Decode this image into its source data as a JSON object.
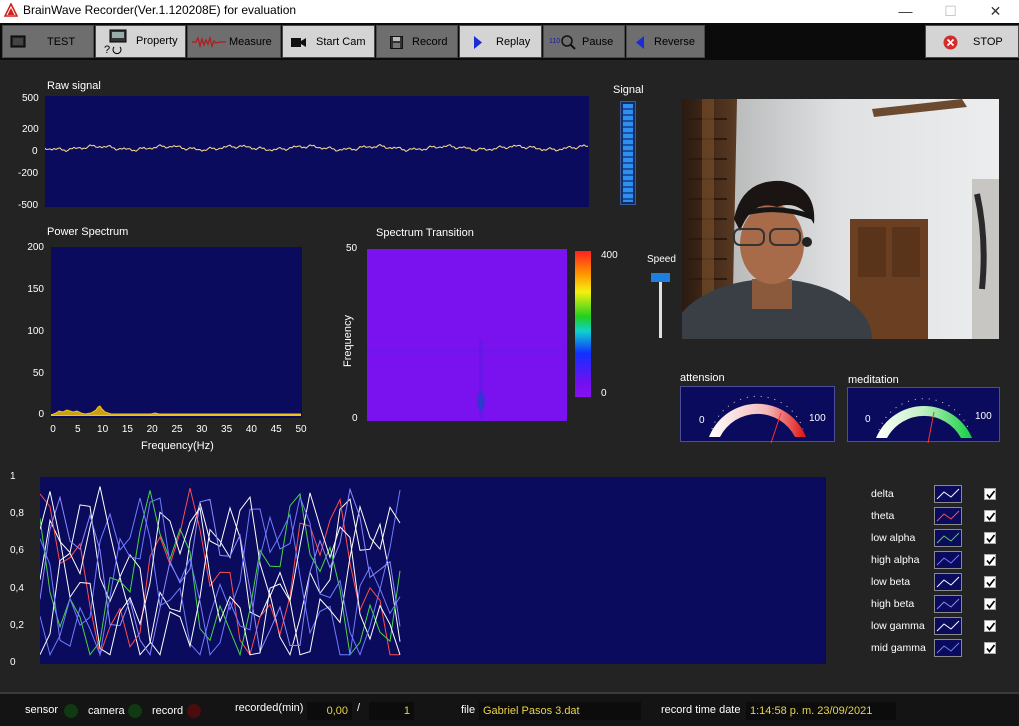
{
  "window": {
    "title": "BrainWave Recorder(Ver.1.120208E) for evaluation",
    "minimize": "—",
    "maximize": "☐",
    "close": "✕"
  },
  "toolbar": {
    "test": "TEST",
    "property": "Property",
    "measure": "Measure",
    "start_cam": "Start Cam",
    "record": "Record",
    "replay": "Replay",
    "pause": "Pause",
    "reverse": "Reverse",
    "stop": "STOP"
  },
  "raw_signal": {
    "title": "Raw signal",
    "yticks": [
      "500",
      "200",
      "0",
      "-200",
      "-500"
    ]
  },
  "signal_meter": {
    "title": "Signal",
    "level": 1.0
  },
  "power_spectrum": {
    "title": "Power Spectrum",
    "yticks": [
      "200",
      "150",
      "100",
      "50",
      "0"
    ],
    "xticks": [
      "0",
      "5",
      "10",
      "15",
      "20",
      "25",
      "30",
      "35",
      "40",
      "45",
      "50"
    ],
    "xlabel": "Frequency(Hz)"
  },
  "spectrum_transition": {
    "title": "Spectrum Transition",
    "ylabel": "Frequency",
    "ytick_top": "50",
    "ytick_bottom": "0",
    "scale_max": "400",
    "scale_min": "0"
  },
  "speed": {
    "title": "Speed"
  },
  "attension": {
    "title": "attension",
    "min": "0",
    "max": "100",
    "value": 72
  },
  "meditation": {
    "title": "meditation",
    "min": "0",
    "max": "100",
    "value": 55
  },
  "bands_chart": {
    "yticks": [
      "1",
      "0,8",
      "0,6",
      "0,4",
      "0,2",
      "0"
    ],
    "legend": [
      {
        "name": "delta",
        "color": "#ffffff"
      },
      {
        "name": "theta",
        "color": "#ff4c4c"
      },
      {
        "name": "low alpha",
        "color": "#46d646"
      },
      {
        "name": "high alpha",
        "color": "#6f7cff"
      },
      {
        "name": "low beta",
        "color": "#ffffff"
      },
      {
        "name": "high beta",
        "color": "#8a8aff"
      },
      {
        "name": "low gamma",
        "color": "#ffffff"
      },
      {
        "name": "mid gamma",
        "color": "#6f7cff"
      }
    ]
  },
  "status": {
    "sensor": "sensor",
    "camera": "camera",
    "record": "record",
    "recorded_label": "recorded(min)",
    "recorded_value": "0,00",
    "separator": "/",
    "total_value": "1",
    "file_label": "file",
    "file_value": "Gabriel Pasos 3.dat",
    "time_label": "record time date",
    "time_value": "1:14:58 p. m. 23/09/2021"
  }
}
